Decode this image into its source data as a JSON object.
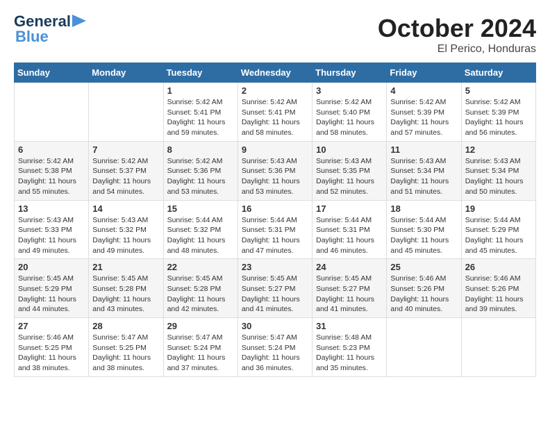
{
  "header": {
    "logo_general": "General",
    "logo_blue": "Blue",
    "month": "October 2024",
    "location": "El Perico, Honduras"
  },
  "days_of_week": [
    "Sunday",
    "Monday",
    "Tuesday",
    "Wednesday",
    "Thursday",
    "Friday",
    "Saturday"
  ],
  "weeks": [
    [
      {
        "day": "",
        "info": ""
      },
      {
        "day": "",
        "info": ""
      },
      {
        "day": "1",
        "info": "Sunrise: 5:42 AM\nSunset: 5:41 PM\nDaylight: 11 hours and 59 minutes."
      },
      {
        "day": "2",
        "info": "Sunrise: 5:42 AM\nSunset: 5:41 PM\nDaylight: 11 hours and 58 minutes."
      },
      {
        "day": "3",
        "info": "Sunrise: 5:42 AM\nSunset: 5:40 PM\nDaylight: 11 hours and 58 minutes."
      },
      {
        "day": "4",
        "info": "Sunrise: 5:42 AM\nSunset: 5:39 PM\nDaylight: 11 hours and 57 minutes."
      },
      {
        "day": "5",
        "info": "Sunrise: 5:42 AM\nSunset: 5:39 PM\nDaylight: 11 hours and 56 minutes."
      }
    ],
    [
      {
        "day": "6",
        "info": "Sunrise: 5:42 AM\nSunset: 5:38 PM\nDaylight: 11 hours and 55 minutes."
      },
      {
        "day": "7",
        "info": "Sunrise: 5:42 AM\nSunset: 5:37 PM\nDaylight: 11 hours and 54 minutes."
      },
      {
        "day": "8",
        "info": "Sunrise: 5:42 AM\nSunset: 5:36 PM\nDaylight: 11 hours and 53 minutes."
      },
      {
        "day": "9",
        "info": "Sunrise: 5:43 AM\nSunset: 5:36 PM\nDaylight: 11 hours and 53 minutes."
      },
      {
        "day": "10",
        "info": "Sunrise: 5:43 AM\nSunset: 5:35 PM\nDaylight: 11 hours and 52 minutes."
      },
      {
        "day": "11",
        "info": "Sunrise: 5:43 AM\nSunset: 5:34 PM\nDaylight: 11 hours and 51 minutes."
      },
      {
        "day": "12",
        "info": "Sunrise: 5:43 AM\nSunset: 5:34 PM\nDaylight: 11 hours and 50 minutes."
      }
    ],
    [
      {
        "day": "13",
        "info": "Sunrise: 5:43 AM\nSunset: 5:33 PM\nDaylight: 11 hours and 49 minutes."
      },
      {
        "day": "14",
        "info": "Sunrise: 5:43 AM\nSunset: 5:32 PM\nDaylight: 11 hours and 49 minutes."
      },
      {
        "day": "15",
        "info": "Sunrise: 5:44 AM\nSunset: 5:32 PM\nDaylight: 11 hours and 48 minutes."
      },
      {
        "day": "16",
        "info": "Sunrise: 5:44 AM\nSunset: 5:31 PM\nDaylight: 11 hours and 47 minutes."
      },
      {
        "day": "17",
        "info": "Sunrise: 5:44 AM\nSunset: 5:31 PM\nDaylight: 11 hours and 46 minutes."
      },
      {
        "day": "18",
        "info": "Sunrise: 5:44 AM\nSunset: 5:30 PM\nDaylight: 11 hours and 45 minutes."
      },
      {
        "day": "19",
        "info": "Sunrise: 5:44 AM\nSunset: 5:29 PM\nDaylight: 11 hours and 45 minutes."
      }
    ],
    [
      {
        "day": "20",
        "info": "Sunrise: 5:45 AM\nSunset: 5:29 PM\nDaylight: 11 hours and 44 minutes."
      },
      {
        "day": "21",
        "info": "Sunrise: 5:45 AM\nSunset: 5:28 PM\nDaylight: 11 hours and 43 minutes."
      },
      {
        "day": "22",
        "info": "Sunrise: 5:45 AM\nSunset: 5:28 PM\nDaylight: 11 hours and 42 minutes."
      },
      {
        "day": "23",
        "info": "Sunrise: 5:45 AM\nSunset: 5:27 PM\nDaylight: 11 hours and 41 minutes."
      },
      {
        "day": "24",
        "info": "Sunrise: 5:45 AM\nSunset: 5:27 PM\nDaylight: 11 hours and 41 minutes."
      },
      {
        "day": "25",
        "info": "Sunrise: 5:46 AM\nSunset: 5:26 PM\nDaylight: 11 hours and 40 minutes."
      },
      {
        "day": "26",
        "info": "Sunrise: 5:46 AM\nSunset: 5:26 PM\nDaylight: 11 hours and 39 minutes."
      }
    ],
    [
      {
        "day": "27",
        "info": "Sunrise: 5:46 AM\nSunset: 5:25 PM\nDaylight: 11 hours and 38 minutes."
      },
      {
        "day": "28",
        "info": "Sunrise: 5:47 AM\nSunset: 5:25 PM\nDaylight: 11 hours and 38 minutes."
      },
      {
        "day": "29",
        "info": "Sunrise: 5:47 AM\nSunset: 5:24 PM\nDaylight: 11 hours and 37 minutes."
      },
      {
        "day": "30",
        "info": "Sunrise: 5:47 AM\nSunset: 5:24 PM\nDaylight: 11 hours and 36 minutes."
      },
      {
        "day": "31",
        "info": "Sunrise: 5:48 AM\nSunset: 5:23 PM\nDaylight: 11 hours and 35 minutes."
      },
      {
        "day": "",
        "info": ""
      },
      {
        "day": "",
        "info": ""
      }
    ]
  ]
}
